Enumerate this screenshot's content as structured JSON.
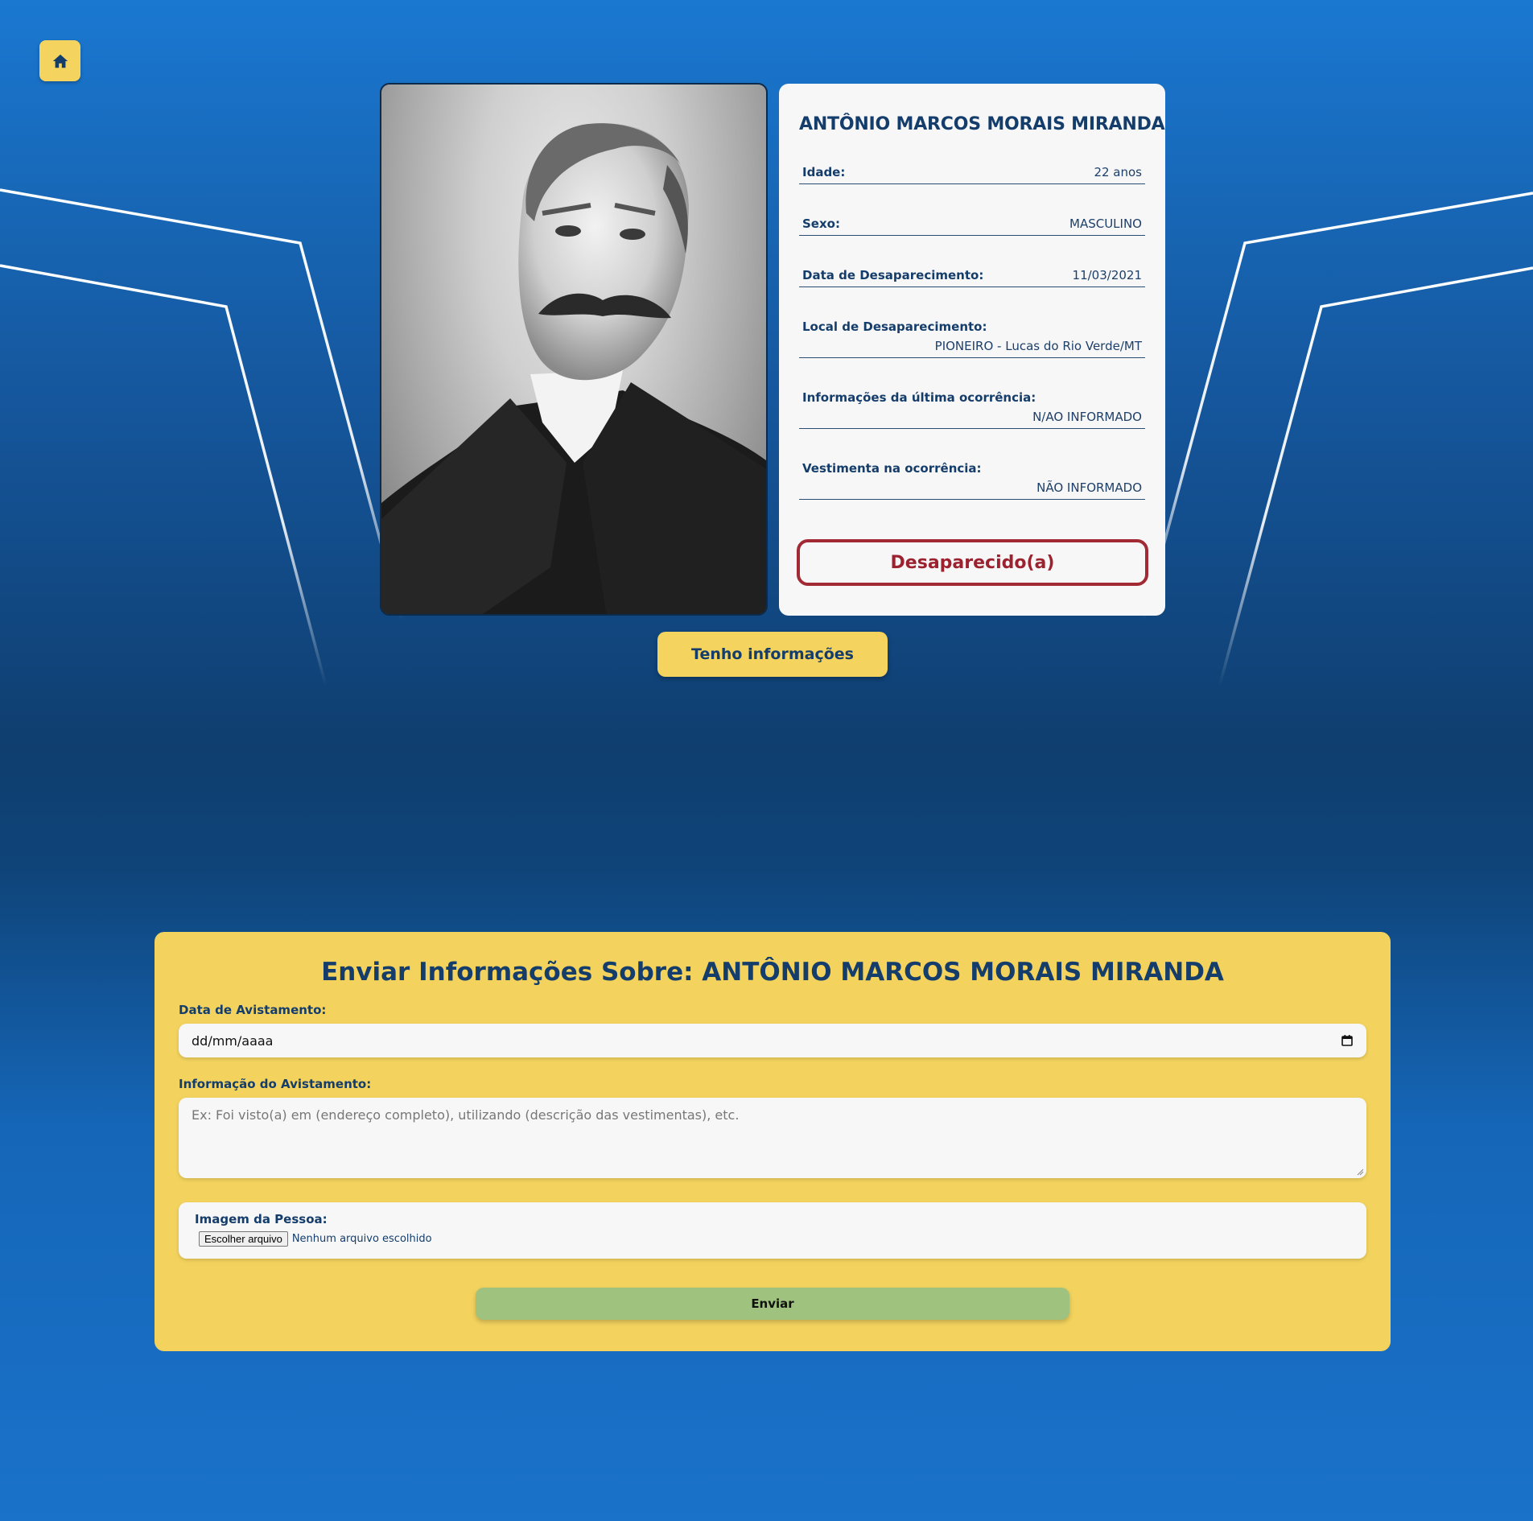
{
  "person": {
    "name": "ANTÔNIO MARCOS MORAIS MIRANDA",
    "fields": {
      "age_label": "Idade:",
      "age_value": "22 anos",
      "sex_label": "Sexo:",
      "sex_value": "MASCULINO",
      "date_label": "Data de Desaparecimento:",
      "date_value": "11/03/2021",
      "place_label": "Local de Desaparecimento:",
      "place_value": "PIONEIRO - Lucas do Rio Verde/MT",
      "info_label": "Informações da última ocorrência:",
      "info_value": "N/AO INFORMADO",
      "clothes_label": "Vestimenta na ocorrência:",
      "clothes_value": "NÃO INFORMADO"
    },
    "status": "Desaparecido(a)"
  },
  "actions": {
    "info_button": "Tenho informações"
  },
  "form": {
    "title": "Enviar Informações Sobre: ANTÔNIO MARCOS MORAIS MIRANDA",
    "date_label": "Data de Avistamento:",
    "date_placeholder": "dd/mm/aaaa",
    "info_label": "Informação do Avistamento:",
    "info_placeholder": "Ex: Foi visto(a) em (endereço completo), utilizando (descrição das vestimentas), etc.",
    "image_label": "Imagem da Pessoa:",
    "file_button": "Escolher arquivo",
    "file_status": "Nenhum arquivo escolhido",
    "submit": "Enviar"
  },
  "colors": {
    "accent_yellow": "#f4d35e",
    "navy": "#143d6b",
    "status_red": "#9c2230",
    "submit_green": "#a0c27f"
  },
  "icons": {
    "home": "home-icon",
    "calendar": "calendar-icon"
  }
}
